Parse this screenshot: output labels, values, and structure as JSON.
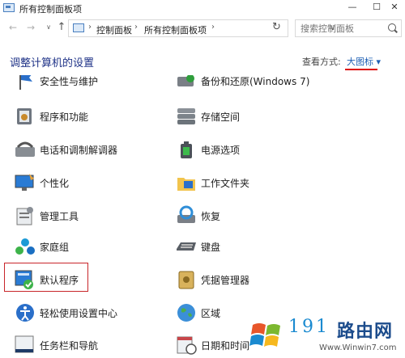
{
  "window": {
    "title": "所有控制面板项",
    "minimize": "—",
    "maximize": "☐",
    "close": "✕"
  },
  "navbar": {
    "back": "←",
    "forward": "→",
    "history": "∨",
    "up": "↑",
    "breadcrumb": [
      "控制面板",
      "所有控制面板项"
    ],
    "separator": "›",
    "dropdown": "∨",
    "refresh": "↻",
    "search_placeholder": "搜索控制面板"
  },
  "header": {
    "title": "调整计算机的设置",
    "view_label": "查看方式:",
    "view_value": "大图标 ▾"
  },
  "items": [
    {
      "label": "安全性与维护",
      "icon": "flag-icon"
    },
    {
      "label": "备份和还原(Windows 7)",
      "icon": "backup-icon"
    },
    {
      "label": "程序和功能",
      "icon": "programs-icon"
    },
    {
      "label": "存储空间",
      "icon": "storage-icon"
    },
    {
      "label": "电话和调制解调器",
      "icon": "phone-modem-icon"
    },
    {
      "label": "电源选项",
      "icon": "power-icon"
    },
    {
      "label": "个性化",
      "icon": "personalization-icon"
    },
    {
      "label": "工作文件夹",
      "icon": "work-folders-icon"
    },
    {
      "label": "管理工具",
      "icon": "admin-tools-icon"
    },
    {
      "label": "恢复",
      "icon": "recovery-icon"
    },
    {
      "label": "家庭组",
      "icon": "homegroup-icon"
    },
    {
      "label": "键盘",
      "icon": "keyboard-icon"
    },
    {
      "label": "默认程序",
      "icon": "default-programs-icon"
    },
    {
      "label": "凭据管理器",
      "icon": "credential-icon"
    },
    {
      "label": "轻松使用设置中心",
      "icon": "ease-of-access-icon"
    },
    {
      "label": "区域",
      "icon": "region-icon"
    },
    {
      "label": "任务栏和导航",
      "icon": "taskbar-icon"
    },
    {
      "label": "日期和时间",
      "icon": "datetime-icon"
    }
  ],
  "watermark": {
    "number": "191",
    "text": "路由网",
    "url": "Www.Winwin7.com"
  }
}
